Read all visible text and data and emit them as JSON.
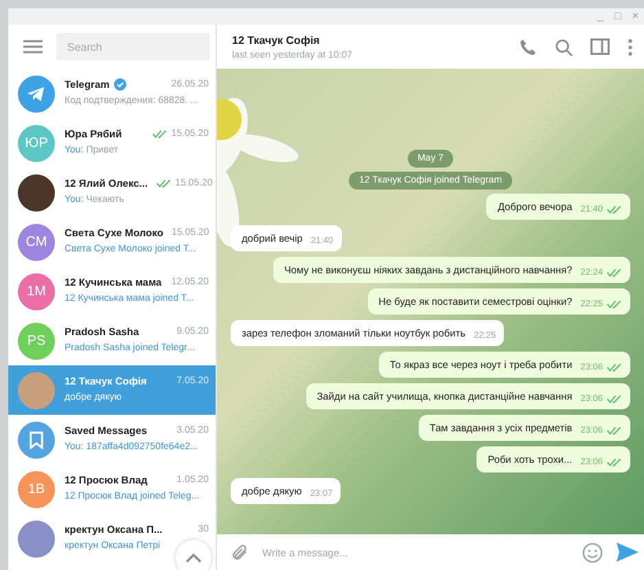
{
  "window": {
    "controls": [
      "_",
      "□",
      "×"
    ]
  },
  "sidebar": {
    "search": {
      "placeholder": "Search"
    },
    "chats": [
      {
        "name": "Telegram",
        "verified": true,
        "date": "26.05.20",
        "preview": "Код подтверждения: 68828. ...",
        "service_preview": false,
        "read": false,
        "selected": false,
        "avatar": {
          "kind": "telegram",
          "color": "#3ea3e6"
        }
      },
      {
        "name": "Юра Рябий",
        "verified": false,
        "date": "15.05.20",
        "prefix": "You:",
        "preview": "Привет",
        "service_preview": false,
        "read": true,
        "selected": false,
        "avatar": {
          "kind": "initials",
          "initials": "ЮР",
          "color": "#5cc7c4"
        }
      },
      {
        "name": "12 Ялий Олекс...",
        "verified": false,
        "date": "15.05.20",
        "prefix": "You:",
        "preview": "Чекають",
        "service_preview": false,
        "read": true,
        "selected": false,
        "avatar": {
          "kind": "photo",
          "color": "#4a3628"
        }
      },
      {
        "name": "Света Сухе Молоко",
        "verified": false,
        "date": "15.05.20",
        "preview": "Света Сухе Молоко joined T...",
        "service_preview": true,
        "read": false,
        "selected": false,
        "avatar": {
          "kind": "initials",
          "initials": "СМ",
          "color": "#9d86e0"
        }
      },
      {
        "name": "12 Кучинська мама",
        "verified": false,
        "date": "12.05.20",
        "preview": "12 Кучинська мама joined T...",
        "service_preview": true,
        "read": false,
        "selected": false,
        "avatar": {
          "kind": "initials",
          "initials": "1М",
          "color": "#ec6ea7"
        }
      },
      {
        "name": "Pradosh Sasha",
        "verified": false,
        "date": "9.05.20",
        "preview": "Pradosh Sasha joined Telegr...",
        "service_preview": true,
        "read": false,
        "selected": false,
        "avatar": {
          "kind": "initials",
          "initials": "PS",
          "color": "#6fcf5a"
        }
      },
      {
        "name": "12 Ткачук Софія",
        "verified": false,
        "date": "7.05.20",
        "preview": "добре дякую",
        "service_preview": false,
        "read": false,
        "selected": true,
        "avatar": {
          "kind": "photo",
          "color": "#c9a07e"
        }
      },
      {
        "name": "Saved Messages",
        "verified": false,
        "date": "3.05.20",
        "preview": "You: 187affa4d092750fe64e2...",
        "service_preview": true,
        "read": false,
        "selected": false,
        "avatar": {
          "kind": "saved",
          "color": "#55a4e2"
        }
      },
      {
        "name": "12 Просюк Влад",
        "verified": false,
        "date": "1.05.20",
        "preview": "12 Просюк Влад joined Teleg...",
        "service_preview": true,
        "read": false,
        "selected": false,
        "avatar": {
          "kind": "initials",
          "initials": "1В",
          "color": "#f7945a"
        }
      },
      {
        "name": "кректун Оксана П...",
        "verified": false,
        "date": "30",
        "preview": "кректун Оксана Петрі",
        "service_preview": true,
        "read": false,
        "selected": false,
        "avatar": {
          "kind": "photo",
          "color": "#8a8fc8"
        }
      }
    ]
  },
  "chat": {
    "title": "12 Ткачук Софія",
    "status": "last seen yesterday at 10:07",
    "messages": [
      {
        "kind": "service",
        "text": "May 7"
      },
      {
        "kind": "service",
        "text": "12 Ткачук Софія joined Telegram"
      },
      {
        "kind": "out",
        "text": "Доброго вечора",
        "time": "21:40"
      },
      {
        "kind": "in",
        "text": "добрий вечір",
        "time": "21:40"
      },
      {
        "kind": "out",
        "text": "Чому не виконуєш ніяких завдань з дистанційного навчання?",
        "time": "22:24"
      },
      {
        "kind": "out",
        "text": "Не буде як поставити семестрові оцінки?",
        "time": "22:25"
      },
      {
        "kind": "in",
        "text": "зарез телефон зломаний тільки ноутбук робить",
        "time": "22:25"
      },
      {
        "kind": "out",
        "text": "То якраз все через ноут і треба робити",
        "time": "23:06"
      },
      {
        "kind": "out",
        "text": "Зайди на сайт училища, кнопка дистанційне навчання",
        "time": "23:06"
      },
      {
        "kind": "out",
        "text": "Там завдання з усіх предметів",
        "time": "23:06"
      },
      {
        "kind": "out",
        "text": "Роби хоть трохи...",
        "time": "23:06"
      },
      {
        "kind": "in",
        "text": "добре дякую",
        "time": "23:07"
      }
    ],
    "composer": {
      "placeholder": "Write a message..."
    }
  }
}
